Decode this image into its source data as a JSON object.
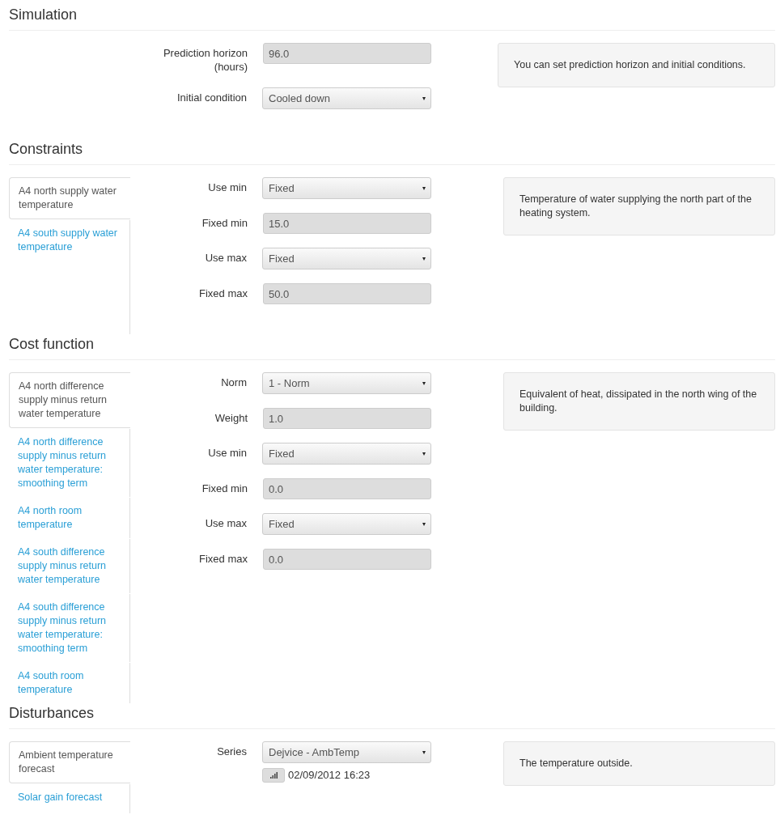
{
  "sections": [
    {
      "title": "Simulation",
      "fields": [
        {
          "kind": "input",
          "label": "Prediction horizon (hours)",
          "value": "96.0"
        },
        {
          "kind": "select",
          "label": "Initial condition",
          "value": "Cooled down"
        }
      ],
      "help": "You can set prediction horizon and initial conditions."
    },
    {
      "title": "Constraints",
      "tabs": [
        {
          "label": "A4 north supply water temperature",
          "selected": true
        },
        {
          "label": "A4 south supply water temperature",
          "selected": false
        }
      ],
      "fields": [
        {
          "kind": "select",
          "label": "Use min",
          "value": "Fixed"
        },
        {
          "kind": "input",
          "label": "Fixed min",
          "value": "15.0"
        },
        {
          "kind": "select",
          "label": "Use max",
          "value": "Fixed"
        },
        {
          "kind": "input",
          "label": "Fixed max",
          "value": "50.0"
        }
      ],
      "help": "Temperature of water supplying the north part of the heating system."
    },
    {
      "title": "Cost function",
      "tabs": [
        {
          "label": "A4 north difference supply minus return water temperature",
          "selected": true
        },
        {
          "label": "A4 north difference supply minus return water temperature: smoothing term",
          "selected": false
        },
        {
          "label": "A4 north room temperature",
          "selected": false
        },
        {
          "label": "A4 south difference supply minus return water temperature",
          "selected": false
        },
        {
          "label": "A4 south difference supply minus return water temperature: smoothing term",
          "selected": false
        },
        {
          "label": "A4 south room temperature",
          "selected": false
        }
      ],
      "fields": [
        {
          "kind": "select",
          "label": "Norm",
          "value": "1 - Norm"
        },
        {
          "kind": "input",
          "label": "Weight",
          "value": "1.0"
        },
        {
          "kind": "select",
          "label": "Use min",
          "value": "Fixed"
        },
        {
          "kind": "input",
          "label": "Fixed min",
          "value": "0.0"
        },
        {
          "kind": "select",
          "label": "Use max",
          "value": "Fixed"
        },
        {
          "kind": "input",
          "label": "Fixed max",
          "value": "0.0"
        }
      ],
      "help": "Equivalent of heat, dissipated in the north wing of the building."
    },
    {
      "title": "Disturbances",
      "tabs": [
        {
          "label": "Ambient temperature forecast",
          "selected": true
        },
        {
          "label": "Solar gain forecast",
          "selected": false
        }
      ],
      "fields": [
        {
          "kind": "select",
          "label": "Series",
          "value": "Dejvice - AmbTemp",
          "timestamp": "02/09/2012 16:23"
        }
      ],
      "help": "The temperature outside."
    }
  ]
}
